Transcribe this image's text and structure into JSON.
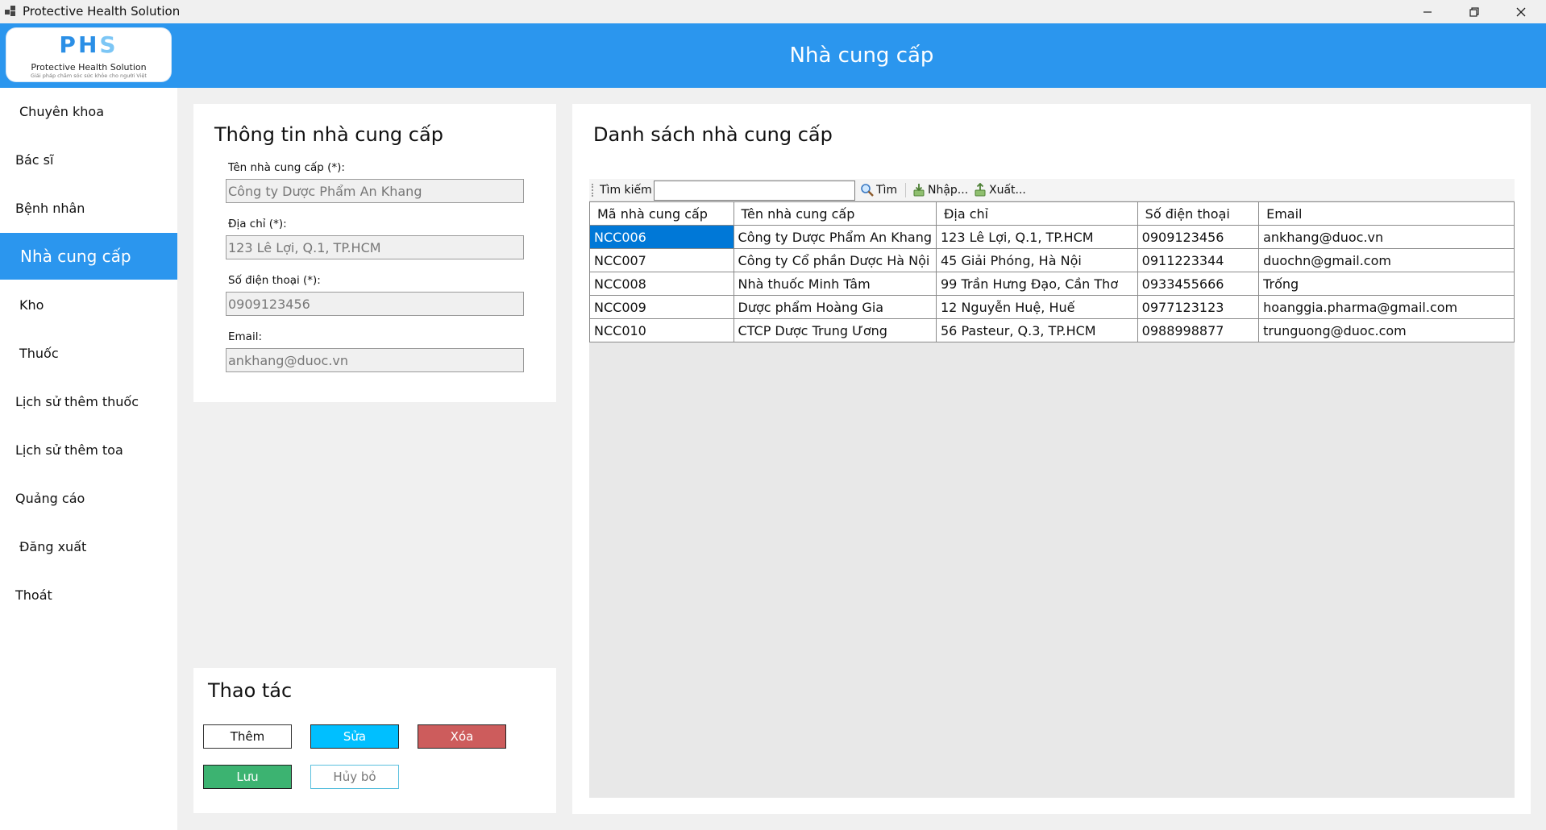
{
  "window": {
    "title": "Protective Health Solution",
    "controls": [
      "minimize",
      "restore",
      "close"
    ]
  },
  "header": {
    "title": "Nhà cung cấp"
  },
  "logo": {
    "letters_main": "PH",
    "letters_accent": "S",
    "name": "Protective Health Solution",
    "tagline": "Giải pháp chăm sóc sức khỏe cho người Việt"
  },
  "sidebar": {
    "items": [
      {
        "label": "Chuyên khoa",
        "active": false
      },
      {
        "label": "Bác sĩ",
        "active": false
      },
      {
        "label": "Bệnh nhân",
        "active": false
      },
      {
        "label": "Nhà cung cấp",
        "active": true
      },
      {
        "label": "Kho",
        "active": false
      },
      {
        "label": "Thuốc",
        "active": false
      },
      {
        "label": "Lịch sử thêm thuốc",
        "active": false
      },
      {
        "label": "Lịch sử thêm toa",
        "active": false
      },
      {
        "label": "Quảng cáo",
        "active": false
      },
      {
        "label": "Đăng xuất",
        "active": false
      },
      {
        "label": "Thoát",
        "active": false
      }
    ]
  },
  "info_panel": {
    "title": "Thông tin nhà cung cấp",
    "fields": [
      {
        "label": "Tên nhà cung cấp (*):",
        "value": "Công ty Dược Phẩm An Khang"
      },
      {
        "label": "Địa chỉ (*):",
        "value": "123 Lê Lợi, Q.1, TP.HCM"
      },
      {
        "label": "Số điện thoại (*):",
        "value": "0909123456"
      },
      {
        "label": "Email:",
        "value": "ankhang@duoc.vn"
      }
    ]
  },
  "actions_panel": {
    "title": "Thao tác",
    "buttons": {
      "add": "Thêm",
      "edit": "Sửa",
      "delete": "Xóa",
      "save": "Lưu",
      "cancel": "Hủy bỏ"
    }
  },
  "list_panel": {
    "title": "Danh sách nhà cung cấp",
    "toolbar": {
      "search_label": "Tìm kiếm",
      "search_value": "",
      "find_label": "Tìm",
      "import_label": "Nhập...",
      "export_label": "Xuất..."
    },
    "columns": [
      "Mã nhà cung cấp",
      "Tên nhà cung cấp",
      "Địa chỉ",
      "Số điện thoại",
      "Email"
    ],
    "rows": [
      [
        "NCC006",
        "Công ty Dược Phẩm An Khang",
        "123 Lê Lợi, Q.1, TP.HCM",
        "0909123456",
        "ankhang@duoc.vn"
      ],
      [
        "NCC007",
        "Công ty Cổ phần Dược Hà Nội",
        "45 Giải Phóng, Hà Nội",
        "0911223344",
        "duochn@gmail.com"
      ],
      [
        "NCC008",
        "Nhà thuốc Minh Tâm",
        "99 Trần Hưng Đạo, Cần Thơ",
        "0933455666",
        "Trống"
      ],
      [
        "NCC009",
        "Dược phẩm Hoàng Gia",
        "12 Nguyễn Huệ, Huế",
        "0977123123",
        "hoanggia.pharma@gmail.com"
      ],
      [
        "NCC010",
        "CTCP Dược Trung Ương",
        "56 Pasteur, Q.3, TP.HCM",
        "0988998877",
        "trunguong@duoc.com"
      ]
    ],
    "selected_row": 0
  },
  "colors": {
    "accent": "#2b96ee",
    "selection": "#0078d7",
    "edit_button": "#00bfff",
    "delete_button": "#cd5c5c",
    "save_button": "#3cb371"
  }
}
